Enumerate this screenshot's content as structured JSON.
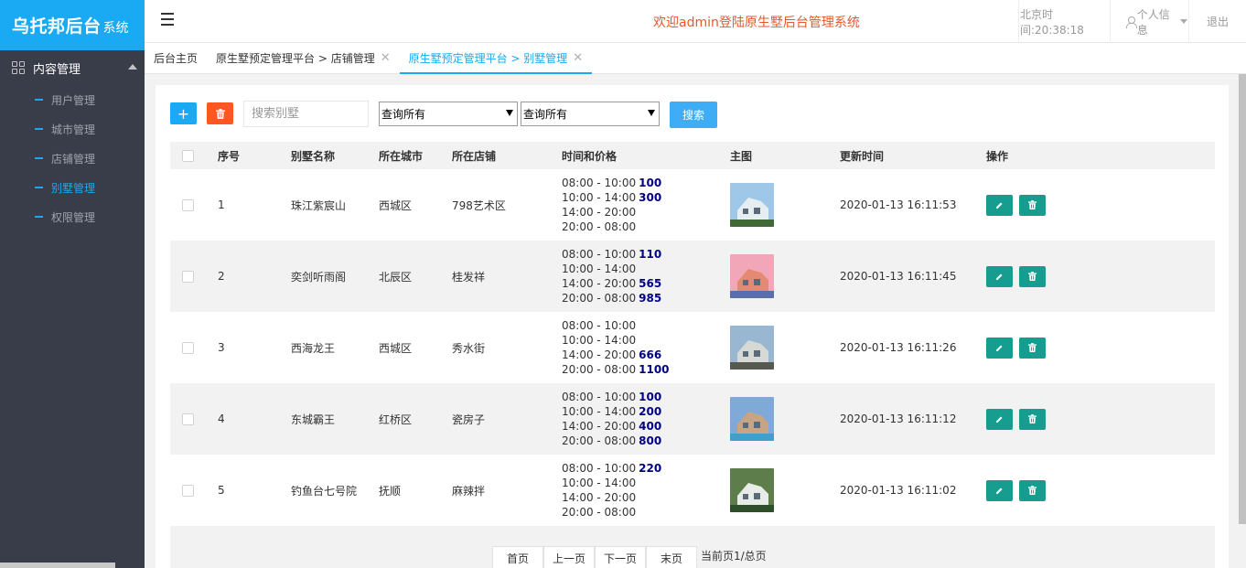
{
  "brand": {
    "main": "乌托邦后台",
    "sub": "系统"
  },
  "sidebar": {
    "group": "内容管理",
    "items": [
      {
        "label": "用户管理",
        "active": false
      },
      {
        "label": "城市管理",
        "active": false
      },
      {
        "label": "店铺管理",
        "active": false
      },
      {
        "label": "别墅管理",
        "active": true
      },
      {
        "label": "权限管理",
        "active": false
      }
    ]
  },
  "header": {
    "welcome": "欢迎admin登陆原生墅后台管理系统",
    "time": "北京时间:20:38:18",
    "user": "个人信息",
    "logout": "退出"
  },
  "tabs": [
    {
      "label": "后台主页",
      "closable": false,
      "active": false
    },
    {
      "label": "原生墅预定管理平台 > 店铺管理",
      "closable": true,
      "active": false
    },
    {
      "label": "原生墅预定管理平台 > 别墅管理",
      "closable": true,
      "active": true
    }
  ],
  "toolbar": {
    "add_label": "+",
    "search_placeholder": "搜索别墅",
    "select1": "查询所有",
    "select2": "查询所有",
    "search_label": "搜索"
  },
  "table": {
    "headers": [
      "序号",
      "别墅名称",
      "所在城市",
      "所在店铺",
      "时间和价格",
      "主图",
      "更新时间",
      "操作"
    ],
    "rows": [
      {
        "id": "1",
        "name": "珠江紫宸山",
        "city": "西城区",
        "shop": "798艺术区",
        "slots": [
          {
            "t": "08:00 - 10:00",
            "p": "100"
          },
          {
            "t": "10:00 - 14:00",
            "p": "300"
          },
          {
            "t": "14:00 - 20:00",
            "p": ""
          },
          {
            "t": "20:00 - 08:00",
            "p": ""
          }
        ],
        "updated": "2020-01-13 16:11:53",
        "img_colors": [
          "#9fc7e8",
          "#e6eef2",
          "#3f6a35"
        ]
      },
      {
        "id": "2",
        "name": "奕剑听雨阁",
        "city": "北辰区",
        "shop": "桂发祥",
        "slots": [
          {
            "t": "08:00 - 10:00",
            "p": "110"
          },
          {
            "t": "10:00 - 14:00",
            "p": ""
          },
          {
            "t": "14:00 - 20:00",
            "p": "565"
          },
          {
            "t": "20:00 - 08:00",
            "p": "985"
          }
        ],
        "updated": "2020-01-13 16:11:45",
        "img_colors": [
          "#f2a7b8",
          "#e58a72",
          "#5a6fa8"
        ]
      },
      {
        "id": "3",
        "name": "西海龙王",
        "city": "西城区",
        "shop": "秀水街",
        "slots": [
          {
            "t": "08:00 - 10:00",
            "p": ""
          },
          {
            "t": "10:00 - 14:00",
            "p": ""
          },
          {
            "t": "14:00 - 20:00",
            "p": "666"
          },
          {
            "t": "20:00 - 08:00",
            "p": "1100"
          }
        ],
        "updated": "2020-01-13 16:11:26",
        "img_colors": [
          "#9ab7d1",
          "#d7d9d6",
          "#56594f"
        ]
      },
      {
        "id": "4",
        "name": "东城霸王",
        "city": "红桥区",
        "shop": "瓷房子",
        "slots": [
          {
            "t": "08:00 - 10:00",
            "p": "100"
          },
          {
            "t": "10:00 - 14:00",
            "p": "200"
          },
          {
            "t": "14:00 - 20:00",
            "p": "400"
          },
          {
            "t": "20:00 - 08:00",
            "p": "800"
          }
        ],
        "updated": "2020-01-13 16:11:12",
        "img_colors": [
          "#7fa9d6",
          "#c7a483",
          "#3fa0c9"
        ]
      },
      {
        "id": "5",
        "name": "钓鱼台七号院",
        "city": "抚顺",
        "shop": "麻辣拌",
        "slots": [
          {
            "t": "08:00 - 10:00",
            "p": "220"
          },
          {
            "t": "10:00 - 14:00",
            "p": ""
          },
          {
            "t": "14:00 - 20:00",
            "p": ""
          },
          {
            "t": "20:00 - 08:00",
            "p": ""
          }
        ],
        "updated": "2020-01-13 16:11:02",
        "img_colors": [
          "#5d7d4b",
          "#e8ece9",
          "#2e4f2a"
        ]
      }
    ]
  },
  "pager": {
    "first": "首页",
    "prev": "上一页",
    "next": "下一页",
    "last": "末页",
    "info": "当前页1/总页"
  },
  "colors": {
    "brand": "#1aa9f3",
    "sidebar": "#393d49",
    "danger": "#ff5722",
    "edit": "#169d8f",
    "welcome": "#e25a2b",
    "price": "#000080"
  },
  "icons": {
    "add": "plus-icon",
    "delete": "trash-icon",
    "edit": "pencil-icon",
    "menu": "hamburger-icon",
    "user": "user-icon"
  }
}
